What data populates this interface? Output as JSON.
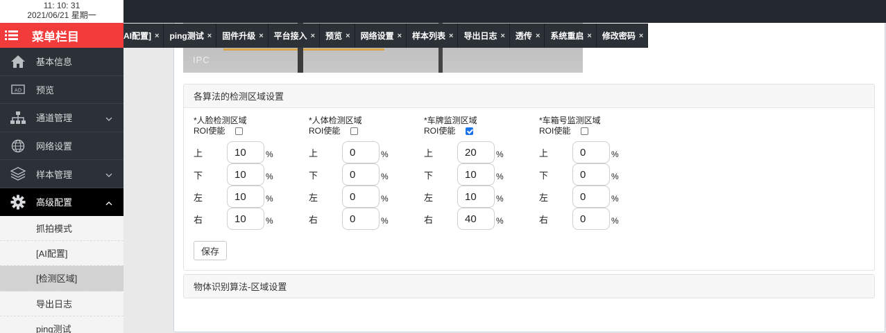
{
  "clock": {
    "time": "11: 10: 31",
    "date": "2021/06/21  星期一"
  },
  "menu": {
    "title": "菜单栏目"
  },
  "nav": [
    {
      "label": "基本信息",
      "icon": "home-icon"
    },
    {
      "label": "预览",
      "icon": "ad-icon"
    },
    {
      "label": "通道管理",
      "icon": "sitemap-icon",
      "expandable": true
    },
    {
      "label": "网络设置",
      "icon": "globe-icon"
    },
    {
      "label": "样本管理",
      "icon": "layers-icon",
      "expandable": true
    },
    {
      "label": "高级配置",
      "icon": "gear-icon",
      "expandable": true,
      "expanded": true
    }
  ],
  "subnav": [
    {
      "label": "抓拍模式"
    },
    {
      "label": "[AI配置]"
    },
    {
      "label": "[检测区域]",
      "active": true
    },
    {
      "label": "导出日志"
    },
    {
      "label": "ping测试"
    }
  ],
  "tabs": [
    {
      "label": "AI配置]"
    },
    {
      "label": "ping测试"
    },
    {
      "label": "固件升级"
    },
    {
      "label": "平台接入"
    },
    {
      "label": "预览"
    },
    {
      "label": "网络设置"
    },
    {
      "label": "样本列表"
    },
    {
      "label": "导出日志"
    },
    {
      "label": "透传"
    },
    {
      "label": "系统重启"
    },
    {
      "label": "修改密码"
    }
  ],
  "tab_close": "×",
  "video": {
    "overlay": "IPC"
  },
  "section1": {
    "title": "各算法的检测区域设置"
  },
  "section2": {
    "title": "物体识别算法-区域设置"
  },
  "field_labels": {
    "top": "上",
    "bottom": "下",
    "left": "左",
    "right": "右",
    "percent": "%",
    "roi": "ROI使能"
  },
  "algorithms": [
    {
      "name": "*人脸检测区域",
      "roi_enabled": false,
      "top": "10",
      "bottom": "10",
      "left": "10",
      "right": "10"
    },
    {
      "name": "*人体检测区域",
      "roi_enabled": false,
      "top": "0",
      "bottom": "0",
      "left": "0",
      "right": "0"
    },
    {
      "name": "*车牌监测区域",
      "roi_enabled": true,
      "top": "20",
      "bottom": "10",
      "left": "10",
      "right": "40"
    },
    {
      "name": "*车箱号监测区域",
      "roi_enabled": false,
      "top": "0",
      "bottom": "0",
      "left": "0",
      "right": "0"
    }
  ],
  "save_label": "保存",
  "colors": {
    "menu_header": "#f23c3c",
    "sidebar_bg": "#2b3137",
    "active_nav": "#000000",
    "checkbox_on": "#1a73e8"
  }
}
